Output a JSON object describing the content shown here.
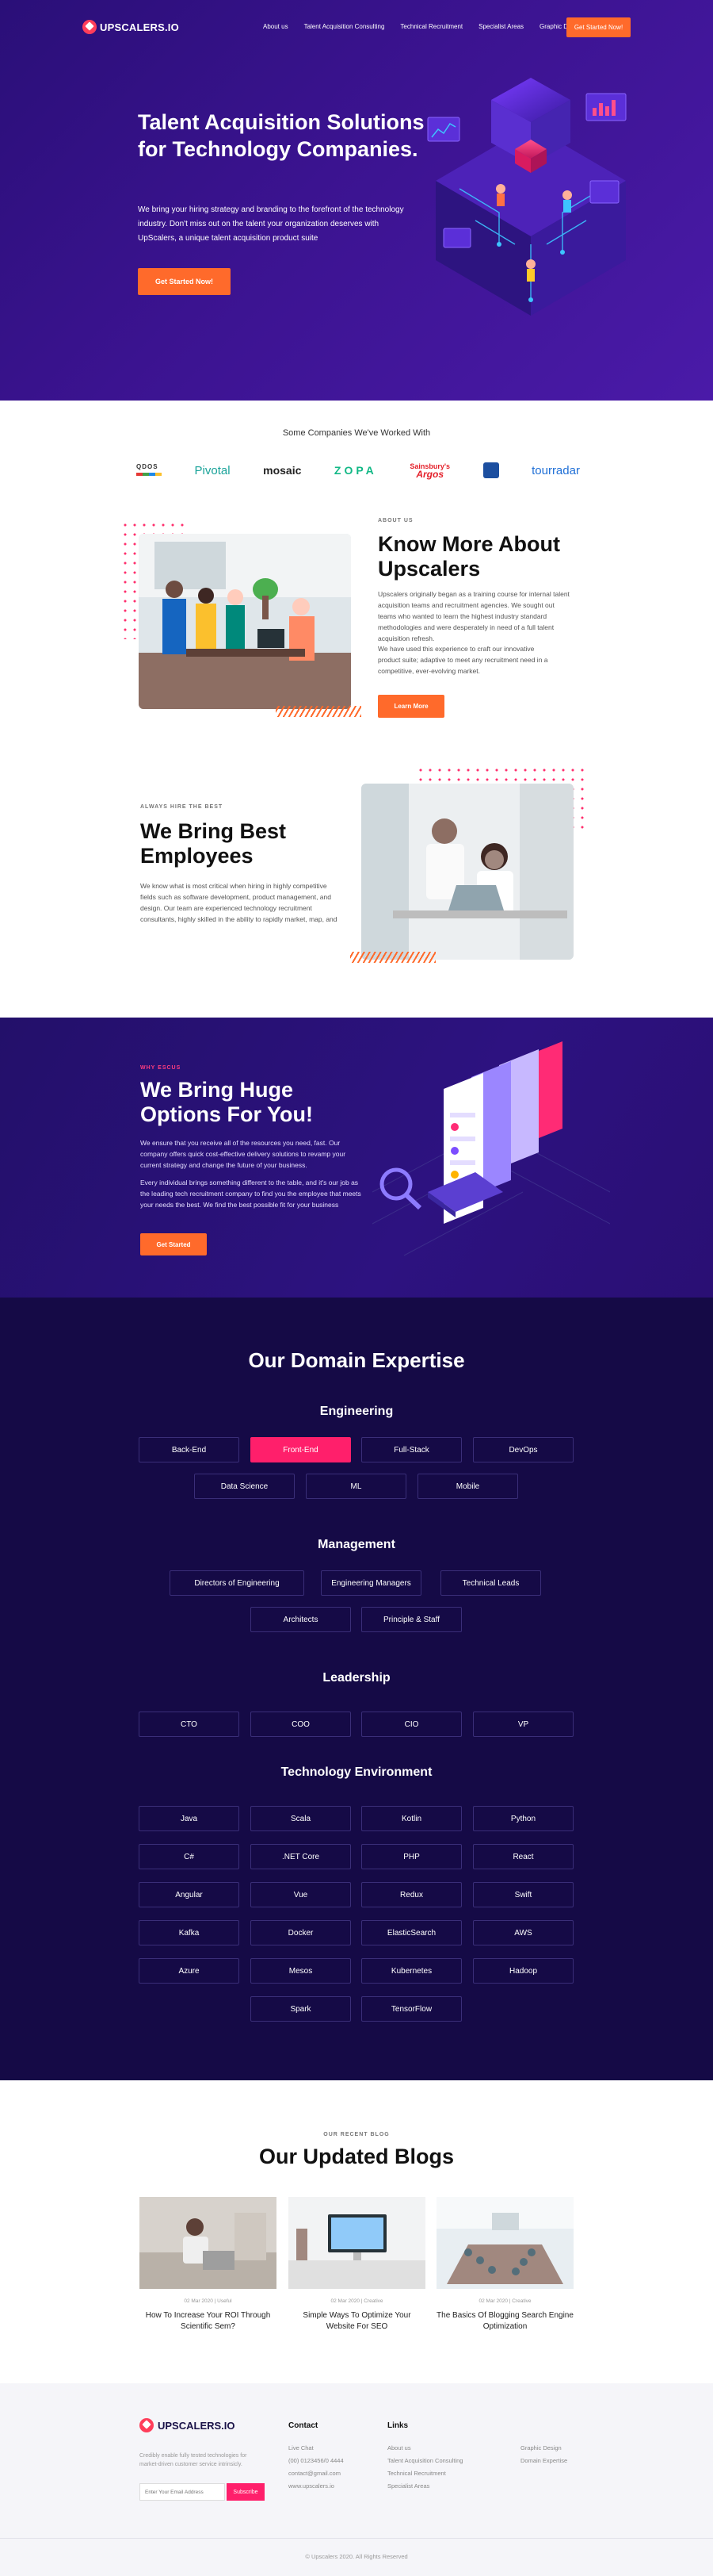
{
  "nav": {
    "brand": "UPSCALERS.IO",
    "links": [
      "About us",
      "Talent Acquisition Consulting",
      "Technical Recruitment",
      "Specialist Areas",
      "Graphic Design"
    ],
    "cta": "Get Started Now!"
  },
  "hero": {
    "title": "Talent Acquisition Solutions for Technology Companies.",
    "subtitle": "We bring your hiring strategy and branding to the forefront of the technology industry. Don't miss out on the talent your organization deserves with UpScalers, a unique talent acquisition product suite",
    "cta": "Get Started Now!"
  },
  "companies": {
    "title": "Some Companies We've Worked With",
    "logos": [
      {
        "name": "3QDOS",
        "color": "#333333"
      },
      {
        "name": "Pivotal",
        "color": "#1aa39a"
      },
      {
        "name": "mosaic",
        "color": "#222222"
      },
      {
        "name": "ZOPA",
        "color": "#12b886"
      },
      {
        "name": "Sainsbury's Argos",
        "color": "#e4202a"
      },
      {
        "name": "Fiverr-like mark",
        "color": "#1c4fa0"
      },
      {
        "name": "tourradar",
        "color": "#1f6fd6"
      }
    ]
  },
  "about": {
    "eyebrow": "ABOUT US",
    "title": "Know More About Upscalers",
    "para1": "Upscalers originally began as a training course for internal talent acquisition teams and recruitment agencies. We sought out teams who wanted to learn the highest industry standard methodologies and were desperately in need of a full talent acquisition refresh.",
    "para2": "We have used this experience to craft our innovative product suite; adaptive to meet any recruitment need in a competitive, ever-evolving market.",
    "cta": "Learn More"
  },
  "best": {
    "eyebrow": "ALWAYS HIRE THE BEST",
    "title": "We Bring Best Employees",
    "para": "We know what is most critical when hiring in highly competitive fields such as software development, product management, and design. Our team are experienced technology recruitment consultants, highly skilled in the ability to rapidly market, map, and"
  },
  "options": {
    "eyebrow": "WHY ESCUS",
    "title": "We Bring Huge Options For You!",
    "para1": "We ensure that you receive all of the resources you need, fast. Our company offers quick cost-effective delivery solutions to revamp your current strategy and change the future of your business.",
    "para2": "Every individual brings something different to the table, and it's our job as the leading tech recruitment company to find you the employee that meets your needs the best. We find the best possible fit for your business",
    "cta": "Get Started"
  },
  "domain": {
    "title": "Our Domain Expertise",
    "groups": [
      {
        "title": "Engineering",
        "items": [
          "Back-End",
          "Front-End",
          "Full-Stack",
          "DevOps",
          "Data Science",
          "ML",
          "Mobile"
        ],
        "active": "Front-End"
      },
      {
        "title": "Management",
        "items": [
          "Directors of Engineering",
          "Engineering Managers",
          "Technical Leads",
          "Architects",
          "Principle & Staff"
        ]
      },
      {
        "title": "Leadership",
        "items": [
          "CTO",
          "COO",
          "CIO",
          "VP"
        ]
      },
      {
        "title": "Technology Environment",
        "items": [
          "Java",
          "Scala",
          "Kotlin",
          "Python",
          "C#",
          ".NET Core",
          "PHP",
          "React",
          "Angular",
          "Vue",
          "Redux",
          "Swift",
          "Kafka",
          "Docker",
          "ElasticSearch",
          "AWS",
          "Azure",
          "Mesos",
          "Kubernetes",
          "Hadoop",
          "Spark",
          "TensorFlow"
        ]
      }
    ]
  },
  "blogs": {
    "eyebrow": "OUR RECENT BLOG",
    "title": "Our Updated Blogs",
    "posts": [
      {
        "meta": "02 Mar 2020 | Useful",
        "title": "How To Increase Your ROI Through Scientific Sem?"
      },
      {
        "meta": "02 Mar 2020 | Creative",
        "title": "Simple Ways To Optimize Your Website For SEO"
      },
      {
        "meta": "02 Mar 2020 | Creative",
        "title": "The Basics Of Blogging Search Engine Optimization"
      }
    ]
  },
  "footer": {
    "brand": "UPSCALERS.IO",
    "desc": "Credibly enable fully tested technologies for market-driven customer service intrinsicly.",
    "email_placeholder": "Enter Your Email Address",
    "subscribe": "Subscribe",
    "contact_title": "Contact",
    "contact": [
      "Live Chat",
      "(00) 0123456/0 4444",
      "contact@gmail.com",
      "www.upscalers.io"
    ],
    "links_title": "Links",
    "links_a": [
      "About us",
      "Talent Acquisition Consulting",
      "Technical Recruitment",
      "Specialist Areas"
    ],
    "links_b": [
      "Graphic Design",
      "Domain Expertise"
    ],
    "copyright": "© Upscalers 2020. All Rights Reserved"
  }
}
